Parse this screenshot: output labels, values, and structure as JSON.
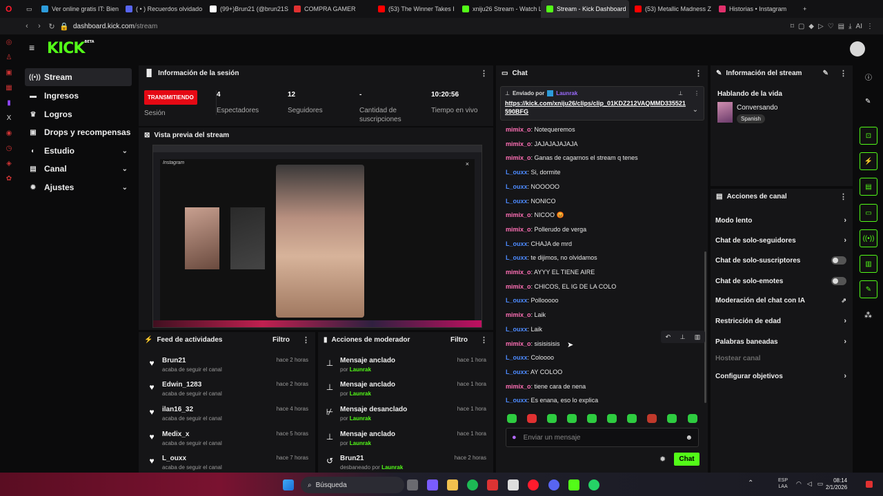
{
  "browser": {
    "tabs": [
      {
        "label": "Ver online gratis IT: Bien",
        "color": "#2d9cdb"
      },
      {
        "label": "( • ) Recuerdos olvidado",
        "color": "#5865f2"
      },
      {
        "label": "(99+)Brun21 (@brun21S",
        "color": "#ffffff"
      },
      {
        "label": "COMPRA GAMER",
        "color": "#e03131"
      },
      {
        "label": "(53) The Winner Takes I",
        "color": "#ff0000"
      },
      {
        "label": "xniju26 Stream - Watch L",
        "color": "#53fc18"
      },
      {
        "label": "Stream - Kick Dashboard",
        "color": "#53fc18"
      },
      {
        "label": "(53) Metallic Madness Z",
        "color": "#ff0000"
      },
      {
        "label": "Historias • Instagram",
        "color": "#e1306c"
      }
    ],
    "url_host": "dashboard.kick.com",
    "url_path": "/stream",
    "ai_label": "AI"
  },
  "brand": {
    "logo": "KICK",
    "tag": "BETA"
  },
  "nav": [
    {
      "label": "Stream",
      "icon": "radio-icon"
    },
    {
      "label": "Ingresos",
      "icon": "money-icon"
    },
    {
      "label": "Logros",
      "icon": "trophy-icon"
    },
    {
      "label": "Drops y recompensas",
      "icon": "gift-icon"
    },
    {
      "label": "Estudio",
      "icon": "studio-icon"
    },
    {
      "label": "Canal",
      "icon": "channel-icon"
    },
    {
      "label": "Ajustes",
      "icon": "gear-icon"
    }
  ],
  "session": {
    "title": "Información de la sesión",
    "live_badge": "TRANSMITIENDO",
    "live_label": "Sesión",
    "stats": [
      {
        "value": "4",
        "label": "Espectadores"
      },
      {
        "value": "12",
        "label": "Seguidores"
      },
      {
        "value": "-",
        "label": "Cantidad de suscripciones"
      },
      {
        "value": "10:20:56",
        "label": "Tiempo en vivo"
      }
    ]
  },
  "preview": {
    "title": "Vista previa del stream",
    "inner_app": "Instagram"
  },
  "feed": {
    "title": "Feed de actividades",
    "filter": "Filtro",
    "items": [
      {
        "name": "Brun21",
        "detail": "acaba de seguir el canal",
        "time": "hace 2 horas"
      },
      {
        "name": "Edwin_1283",
        "detail": "acaba de seguir el canal",
        "time": "hace 2 horas"
      },
      {
        "name": "ilan16_32",
        "detail": "acaba de seguir el canal",
        "time": "hace 4 horas"
      },
      {
        "name": "Medix_x",
        "detail": "acaba de seguir el canal",
        "time": "hace 5 horas"
      },
      {
        "name": "L_ouxx",
        "detail": "acaba de seguir el canal",
        "time": "hace 7 horas"
      }
    ]
  },
  "modactions": {
    "title": "Acciones de moderador",
    "filter": "Filtro",
    "items": [
      {
        "name": "Mensaje anclado",
        "by": "por",
        "who": "Launrak",
        "time": "hace 1 hora",
        "icon": "pin-icon"
      },
      {
        "name": "Mensaje anclado",
        "by": "por",
        "who": "Launrak",
        "time": "hace 1 hora",
        "icon": "pin-icon"
      },
      {
        "name": "Mensaje desanclado",
        "by": "por",
        "who": "Launrak",
        "time": "hace 1 hora",
        "icon": "unpin-icon"
      },
      {
        "name": "Mensaje anclado",
        "by": "por",
        "who": "Launrak",
        "time": "hace 1 hora",
        "icon": "pin-icon"
      },
      {
        "name": "Brun21",
        "by": "desbaneado por",
        "who": "Launrak",
        "time": "hace 2 horas",
        "icon": "undo-icon"
      }
    ]
  },
  "chat": {
    "title": "Chat",
    "pinned_by_label": "Enviado por",
    "pinned_by": "Launrak",
    "pinned_link": "https://kick.com/xniju26/clips/clip_01KDZ212VAQMMD335521590BFG",
    "messages": [
      {
        "user": "mimix_o",
        "color": "pink",
        "text": "Notequeremos"
      },
      {
        "user": "mimix_o",
        "color": "pink",
        "text": "JAJAJAJAJAJA"
      },
      {
        "user": "mimix_o",
        "color": "pink",
        "text": "Ganas de cagarnos el stream q tenes"
      },
      {
        "user": "L_ouxx",
        "color": "blue",
        "text": "Si, dormite"
      },
      {
        "user": "L_ouxx",
        "color": "blue",
        "text": "NOOOOO"
      },
      {
        "user": "L_ouxx",
        "color": "blue",
        "text": "NONICO"
      },
      {
        "user": "mimix_o",
        "color": "pink",
        "text": "NICOO 😡"
      },
      {
        "user": "mimix_o",
        "color": "pink",
        "text": "Pollerudo de verga"
      },
      {
        "user": "L_ouxx",
        "color": "blue",
        "text": "CHAJA de mrd"
      },
      {
        "user": "L_ouxx",
        "color": "blue",
        "text": "te dijimos, no olvidamos"
      },
      {
        "user": "mimix_o",
        "color": "pink",
        "text": "AYYY EL TIENE AIRE"
      },
      {
        "user": "mimix_o",
        "color": "pink",
        "text": "CHICOS, EL IG DE LA COLO"
      },
      {
        "user": "L_ouxx",
        "color": "blue",
        "text": "Pollooooo"
      },
      {
        "user": "mimix_o",
        "color": "pink",
        "text": "Laik"
      },
      {
        "user": "L_ouxx",
        "color": "blue",
        "text": "Laik"
      },
      {
        "user": "mimix_o",
        "color": "pink",
        "text": "sisisisisis"
      },
      {
        "user": "L_ouxx",
        "color": "blue",
        "text": "Coloooo"
      },
      {
        "user": "L_ouxx",
        "color": "blue",
        "text": "AY COLOO"
      },
      {
        "user": "mimix_o",
        "color": "pink",
        "text": "tiene cara de nena"
      },
      {
        "user": "L_ouxx",
        "color": "blue",
        "text": "Es enana, eso lo explica"
      }
    ],
    "input_placeholder": "Enviar un mensaje",
    "send_label": "Chat"
  },
  "streaminfo": {
    "title": "Información del stream",
    "stream_title": "Hablando de la vida",
    "category": "Conversando",
    "language": "Spanish"
  },
  "channel_actions": {
    "title": "Acciones de canal",
    "items": [
      {
        "label": "Modo lento",
        "control": "arrow"
      },
      {
        "label": "Chat de solo-seguidores",
        "control": "arrow"
      },
      {
        "label": "Chat de solo-suscriptores",
        "control": "toggle"
      },
      {
        "label": "Chat de solo-emotes",
        "control": "toggle"
      },
      {
        "label": "Moderación del chat con IA",
        "control": "external"
      },
      {
        "label": "Restricción de edad",
        "control": "arrow"
      },
      {
        "label": "Palabras baneadas",
        "control": "arrow"
      },
      {
        "label": "Hostear canal",
        "control": "disabled"
      },
      {
        "label": "Configurar objetivos",
        "control": "arrow"
      }
    ]
  },
  "taskbar": {
    "search": "Búsqueda",
    "lang": "ESP",
    "lang2": "LAA",
    "time": "08:14",
    "date": "2/1/2026"
  },
  "colors": {
    "accent": "#53fc18",
    "live": "#e50914",
    "pink_user": "#ff6fb5",
    "blue_user": "#4d8bff"
  }
}
